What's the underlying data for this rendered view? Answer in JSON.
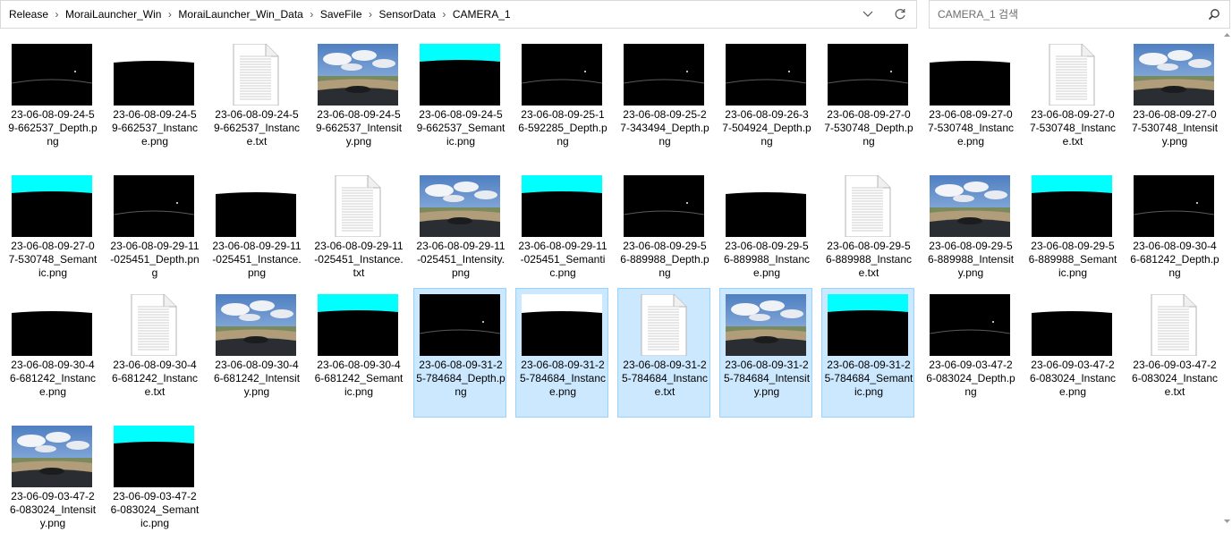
{
  "breadcrumb": [
    "Release",
    "MoraiLauncher_Win",
    "MoraiLauncher_Win_Data",
    "SaveFile",
    "SensorData",
    "CAMERA_1"
  ],
  "search": {
    "placeholder": "CAMERA_1 검색"
  },
  "files": [
    {
      "name": "23-06-08-09-24-59-662537_Depth.png",
      "type": "depth",
      "selected": false
    },
    {
      "name": "23-06-08-09-24-59-662537_Instance.png",
      "type": "instance",
      "selected": false
    },
    {
      "name": "23-06-08-09-24-59-662537_Instance.txt",
      "type": "txt",
      "selected": false
    },
    {
      "name": "23-06-08-09-24-59-662537_Intensity.png",
      "type": "intensity",
      "selected": false
    },
    {
      "name": "23-06-08-09-24-59-662537_Semantic.png",
      "type": "semantic",
      "selected": false
    },
    {
      "name": "23-06-08-09-25-16-592285_Depth.png",
      "type": "depth",
      "selected": false
    },
    {
      "name": "23-06-08-09-25-27-343494_Depth.png",
      "type": "depth",
      "selected": false
    },
    {
      "name": "23-06-08-09-26-37-504924_Depth.png",
      "type": "depth",
      "selected": false
    },
    {
      "name": "23-06-08-09-27-07-530748_Depth.png",
      "type": "depth",
      "selected": false
    },
    {
      "name": "23-06-08-09-27-07-530748_Instance.png",
      "type": "instance",
      "selected": false
    },
    {
      "name": "23-06-08-09-27-07-530748_Instance.txt",
      "type": "txt",
      "selected": false
    },
    {
      "name": "23-06-08-09-27-07-530748_Intensity.png",
      "type": "intensity",
      "selected": false
    },
    {
      "name": "23-06-08-09-27-07-530748_Semantic.png",
      "type": "semantic",
      "selected": false
    },
    {
      "name": "23-06-08-09-29-11-025451_Depth.png",
      "type": "depth",
      "selected": false
    },
    {
      "name": "23-06-08-09-29-11-025451_Instance.png",
      "type": "instance",
      "selected": false
    },
    {
      "name": "23-06-08-09-29-11-025451_Instance.txt",
      "type": "txt",
      "selected": false
    },
    {
      "name": "23-06-08-09-29-11-025451_Intensity.png",
      "type": "intensity",
      "selected": false
    },
    {
      "name": "23-06-08-09-29-11-025451_Semantic.png",
      "type": "semantic",
      "selected": false
    },
    {
      "name": "23-06-08-09-29-56-889988_Depth.png",
      "type": "depth",
      "selected": false
    },
    {
      "name": "23-06-08-09-29-56-889988_Instance.png",
      "type": "instance",
      "selected": false
    },
    {
      "name": "23-06-08-09-29-56-889988_Instance.txt",
      "type": "txt",
      "selected": false
    },
    {
      "name": "23-06-08-09-29-56-889988_Intensity.png",
      "type": "intensity",
      "selected": false
    },
    {
      "name": "23-06-08-09-29-56-889988_Semantic.png",
      "type": "semantic",
      "selected": false
    },
    {
      "name": "23-06-08-09-30-46-681242_Depth.png",
      "type": "depth",
      "selected": false
    },
    {
      "name": "23-06-08-09-30-46-681242_Instance.png",
      "type": "instance",
      "selected": false
    },
    {
      "name": "23-06-08-09-30-46-681242_Instance.txt",
      "type": "txt",
      "selected": false
    },
    {
      "name": "23-06-08-09-30-46-681242_Intensity.png",
      "type": "intensity",
      "selected": false
    },
    {
      "name": "23-06-08-09-30-46-681242_Semantic.png",
      "type": "semantic",
      "selected": false
    },
    {
      "name": "23-06-08-09-31-25-784684_Depth.png",
      "type": "depth",
      "selected": true
    },
    {
      "name": "23-06-08-09-31-25-784684_Instance.png",
      "type": "instance",
      "selected": true
    },
    {
      "name": "23-06-08-09-31-25-784684_Instance.txt",
      "type": "txt",
      "selected": true
    },
    {
      "name": "23-06-08-09-31-25-784684_Intensity.png",
      "type": "intensity",
      "selected": true
    },
    {
      "name": "23-06-08-09-31-25-784684_Semantic.png",
      "type": "semantic",
      "selected": true
    },
    {
      "name": "23-06-09-03-47-26-083024_Depth.png",
      "type": "depth",
      "selected": false
    },
    {
      "name": "23-06-09-03-47-26-083024_Instance.png",
      "type": "instance",
      "selected": false
    },
    {
      "name": "23-06-09-03-47-26-083024_Instance.txt",
      "type": "txt",
      "selected": false
    },
    {
      "name": "23-06-09-03-47-26-083024_Intensity.png",
      "type": "intensity",
      "selected": false
    },
    {
      "name": "23-06-09-03-47-26-083024_Semantic.png",
      "type": "semantic",
      "selected": false
    }
  ],
  "icons": {
    "dropdown": "chevron-down-icon",
    "refresh": "refresh-icon",
    "search": "search-icon"
  },
  "colors": {
    "selection_bg": "#cce8ff",
    "selection_border": "#99d1ff",
    "semantic_sky": "#00ffff"
  }
}
